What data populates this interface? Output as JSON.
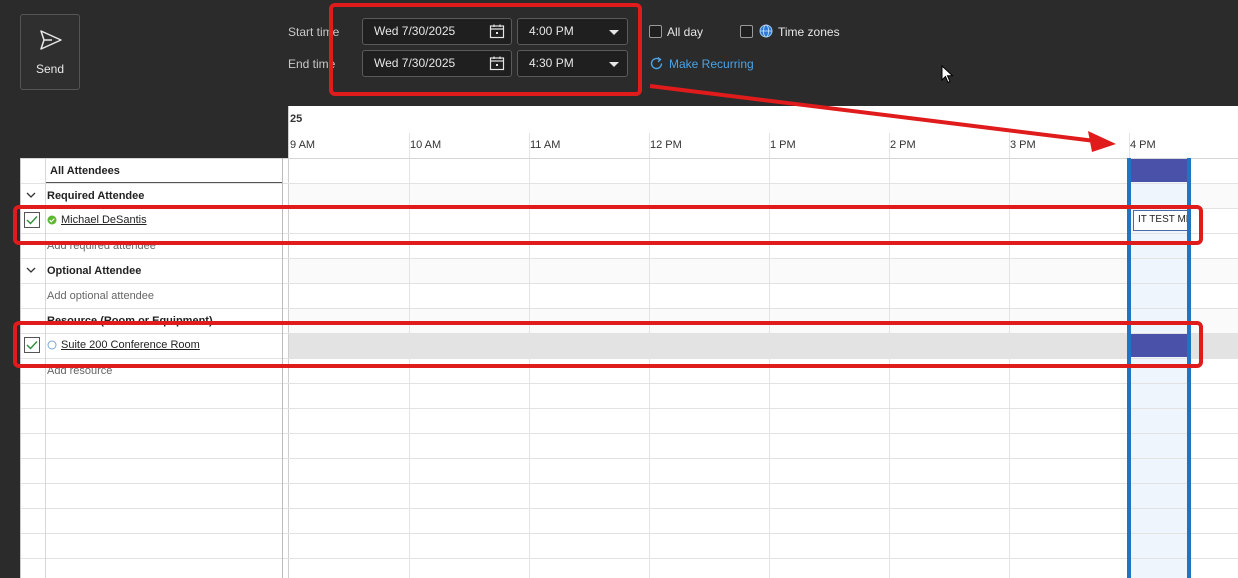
{
  "toolbar": {
    "send_label": "Send"
  },
  "times": {
    "start_label": "Start time",
    "end_label": "End time",
    "start_date": "Wed 7/30/2025",
    "start_time": "4:00 PM",
    "end_date": "Wed 7/30/2025",
    "end_time": "4:30 PM",
    "all_day_label": "All day",
    "time_zones_label": "Time zones",
    "make_recurring_label": "Make Recurring"
  },
  "timeline": {
    "date_fragment": "25",
    "hours": [
      "9 AM",
      "10 AM",
      "11 AM",
      "12 PM",
      "1 PM",
      "2 PM",
      "3 PM",
      "4 PM"
    ]
  },
  "attendees": {
    "all_label": "All Attendees",
    "required_header": "Required Attendee",
    "required_name": "Michael DeSantis",
    "add_required": "Add required attendee",
    "optional_header": "Optional Attendee",
    "add_optional": "Add optional attendee",
    "resource_header": "Resource (Room or Equipment)",
    "resource_name": "Suite 200 Conference Room",
    "add_resource": "Add resource"
  },
  "meeting": {
    "label": "IT TEST ME"
  },
  "colors": {
    "busy": "#4a51a8",
    "accent": "#1f74c4",
    "annotation": "#e01b1b",
    "available": "#5cb82e"
  }
}
